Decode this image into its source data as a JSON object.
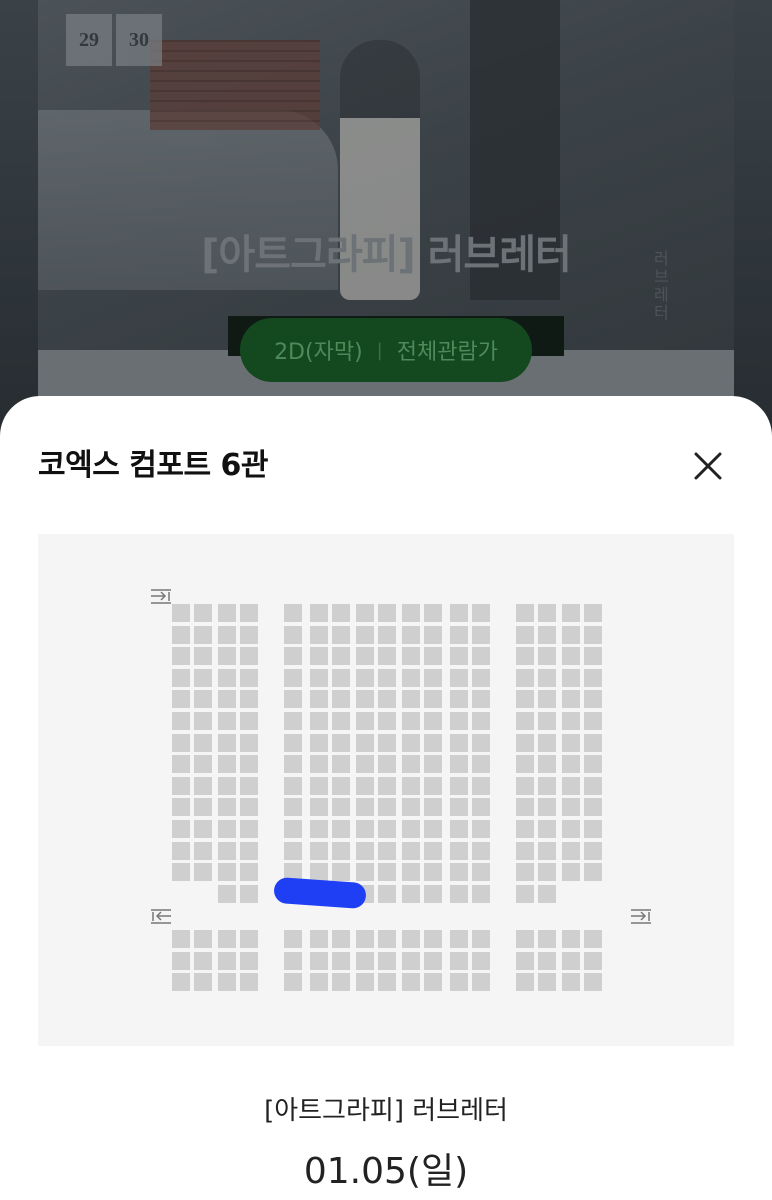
{
  "poster": {
    "badge_left": "29",
    "badge_right": "30",
    "title": "[아트그라피] 러브레터",
    "vertical_text": "러브레터"
  },
  "pill": {
    "format": "2D(자막)",
    "separator": "|",
    "rating": "전체관람가"
  },
  "sheet": {
    "title": "코엑스 컴포트 6관",
    "close_icon": "close-icon"
  },
  "seatmap": {
    "aisle_markers": [
      "entrance-arrow-top-left",
      "exit-arrow-mid-left",
      "entrance-arrow-mid-right"
    ],
    "seat_color": "#cfcfcf",
    "background_color": "#f5f5f5",
    "highlight_color": "#1f3ff5"
  },
  "movie": {
    "name": "[아트그라피] 러브레터",
    "date": "01.05(일)"
  }
}
